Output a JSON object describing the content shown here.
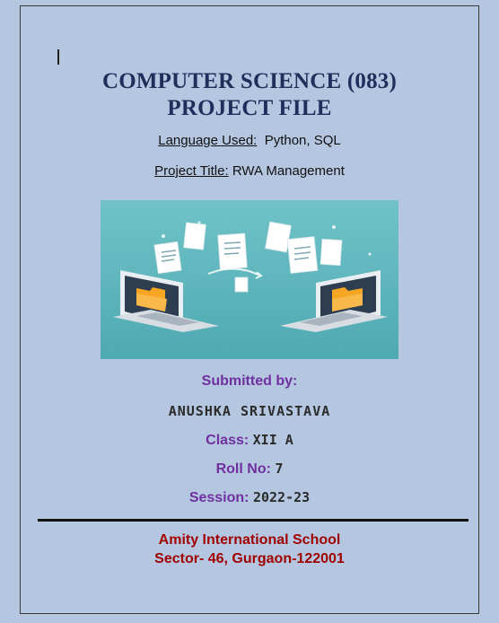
{
  "title": {
    "line1": "COMPUTER SCIENCE (083)",
    "line2": "PROJECT FILE"
  },
  "language": {
    "label": "Language Used:",
    "value": "Python, SQL"
  },
  "project": {
    "label": "Project Title:",
    "value": "RWA Management"
  },
  "illustration": {
    "icon": "laptops-file-transfer-illustration",
    "bg_color": "#5fb6bd"
  },
  "submitted": {
    "heading": "Submitted by:",
    "name": "ANUSHKA SRIVASTAVA",
    "class_label": "Class:",
    "class_value": "XII A",
    "roll_label": "Roll No:",
    "roll_value": "7",
    "session_label": "Session:",
    "session_value": "2022-23"
  },
  "school": {
    "name": "Amity International School",
    "address": "Sector- 46, Gurgaon-122001"
  },
  "colors": {
    "page_bg": "#b4c6e0",
    "title": "#1f2f5c",
    "label_purple": "#7030a0",
    "school_red": "#a00000"
  }
}
